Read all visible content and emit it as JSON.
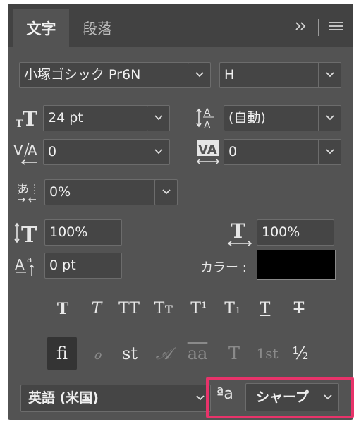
{
  "tabs": [
    {
      "label": "文字",
      "active": true
    },
    {
      "label": "段落",
      "active": false
    }
  ],
  "tab_controls": {
    "expand": "»",
    "menu": "≡"
  },
  "font_family": "小塚ゴシック Pr6N",
  "font_style": "H",
  "font_size": "24 pt",
  "leading": "(自動)",
  "kerning": "0",
  "tracking": "0",
  "tsume": "0%",
  "vertical_scale": "100%",
  "horizontal_scale": "100%",
  "baseline_shift": "0 pt",
  "color_label": "カラー :",
  "color_value": "#000000",
  "style_buttons": [
    {
      "name": "faux-bold",
      "glyph": "T"
    },
    {
      "name": "faux-italic",
      "glyph": "T"
    },
    {
      "name": "all-caps",
      "glyph": "TT"
    },
    {
      "name": "small-caps",
      "glyph": "Tт"
    },
    {
      "name": "superscript",
      "glyph": "T¹"
    },
    {
      "name": "subscript",
      "glyph": "T₁"
    },
    {
      "name": "underline",
      "glyph": "T"
    },
    {
      "name": "strikethrough",
      "glyph": "T"
    }
  ],
  "opentype_buttons": [
    {
      "name": "standard-ligatures",
      "glyph": "fi"
    },
    {
      "name": "contextual-alternates",
      "glyph": "ℴ"
    },
    {
      "name": "discretionary-ligatures",
      "glyph": "st"
    },
    {
      "name": "swash",
      "glyph": "𝒜"
    },
    {
      "name": "stylistic-alternates",
      "glyph": "aa"
    },
    {
      "name": "titling-alternates",
      "glyph": "T"
    },
    {
      "name": "ordinals",
      "glyph": "1st"
    },
    {
      "name": "fractions",
      "glyph": "½"
    }
  ],
  "language": "英語 (米国)",
  "antialias": {
    "icon": "ªa",
    "value": "シャープ"
  },
  "highlight_color": "#e8336a"
}
